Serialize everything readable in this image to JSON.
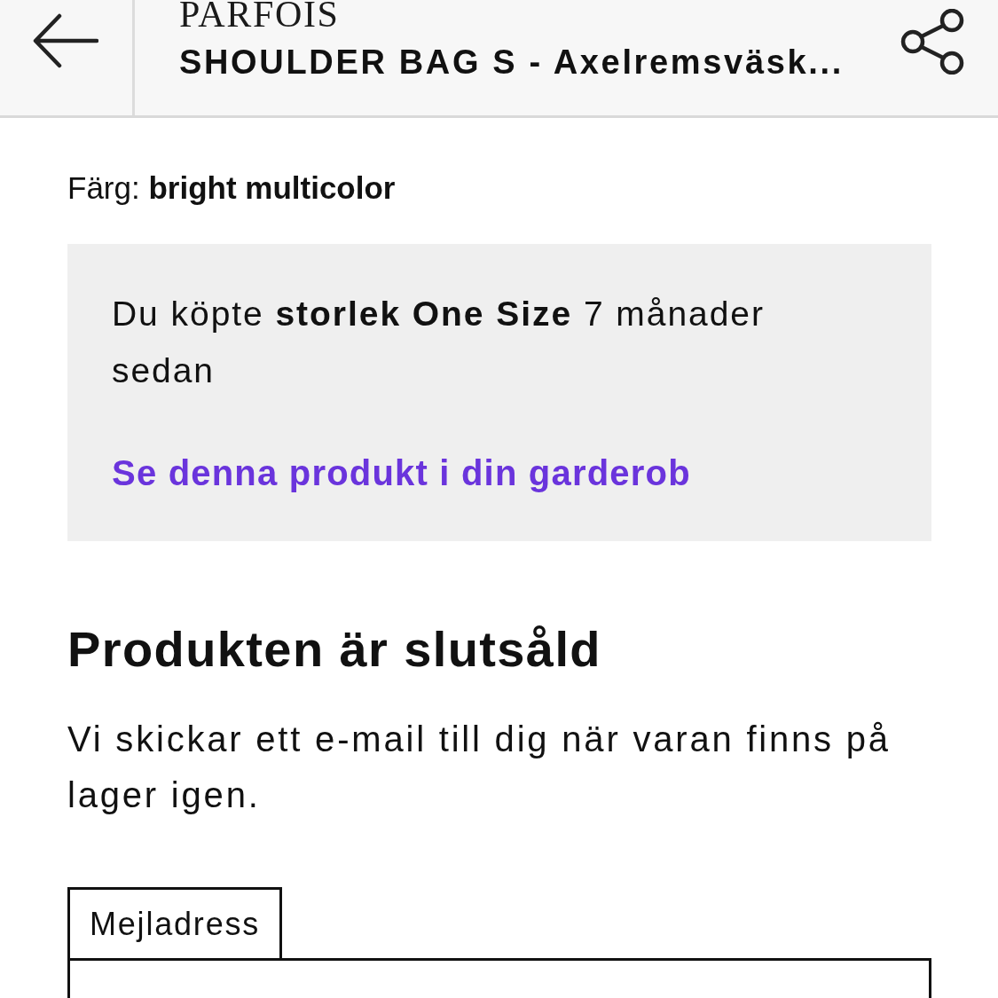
{
  "header": {
    "brand": "PARFOIS",
    "title": "SHOULDER BAG S - Axelremsväsk..."
  },
  "color_line": "Färg: **bright multicolor**",
  "purchase_notice": {
    "text": "Du köpte **storlek One Size** 7 månader sedan",
    "link": "Se denna produkt i din garderob"
  },
  "sold_out": {
    "heading": "Produkten är slutsåld",
    "message": "Vi skickar ett e-mail till dig när varan finns på lager igen."
  },
  "email_field": {
    "label": "Mejladress"
  }
}
